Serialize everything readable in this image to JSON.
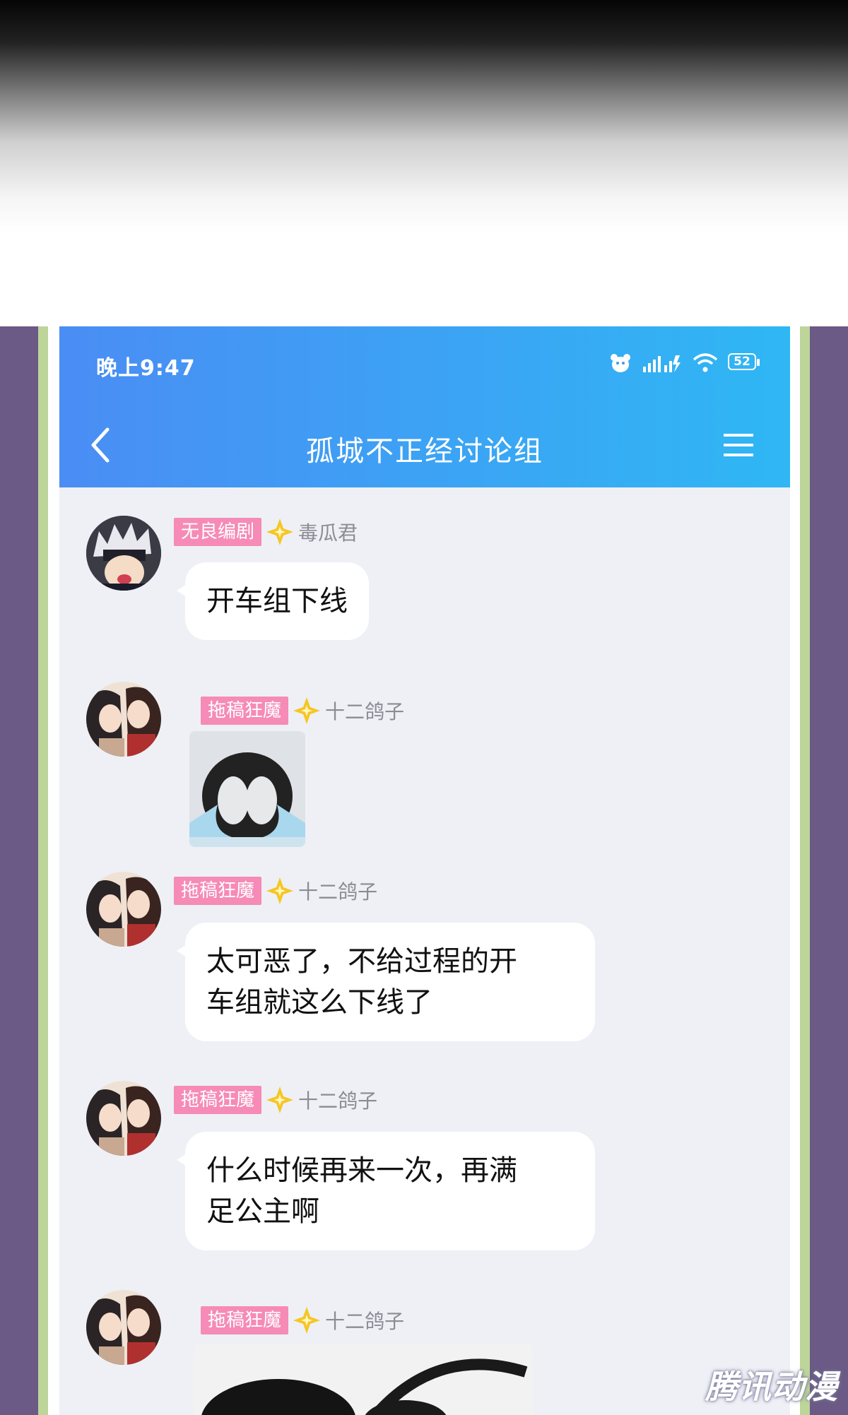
{
  "status_bar": {
    "time": "晚上9:47",
    "battery": "52"
  },
  "header": {
    "title": "孤城不正经讨论组"
  },
  "messages": [
    {
      "tag": "无良编剧",
      "name": "毒瓜君",
      "text": "开车组下线"
    },
    {
      "tag": "拖稿狂魔",
      "name": "十二鸽子",
      "type": "sticker"
    },
    {
      "tag": "拖稿狂魔",
      "name": "十二鸽子",
      "text_line1": "太可恶了，不给过程的开",
      "text_line2": "车组就这么下线了"
    },
    {
      "tag": "拖稿狂魔",
      "name": "十二鸽子",
      "text_line1": "什么时候再来一次，再满",
      "text_line2": "足公主啊"
    },
    {
      "tag": "拖稿狂魔",
      "name": "十二鸽子",
      "type": "sticker"
    }
  ],
  "watermark": "腾讯动漫",
  "colors": {
    "appbar_start": "#4a8df4",
    "appbar_end": "#2fb7f4",
    "tag_bg": "#f58bb6",
    "chat_bg": "#eef0f6",
    "border_purple": "#6a5a85",
    "border_green": "#bed59a"
  },
  "icons": {
    "back": "chevron-left-icon",
    "menu": "hamburger-menu-icon",
    "badge": "star-badge-icon"
  }
}
